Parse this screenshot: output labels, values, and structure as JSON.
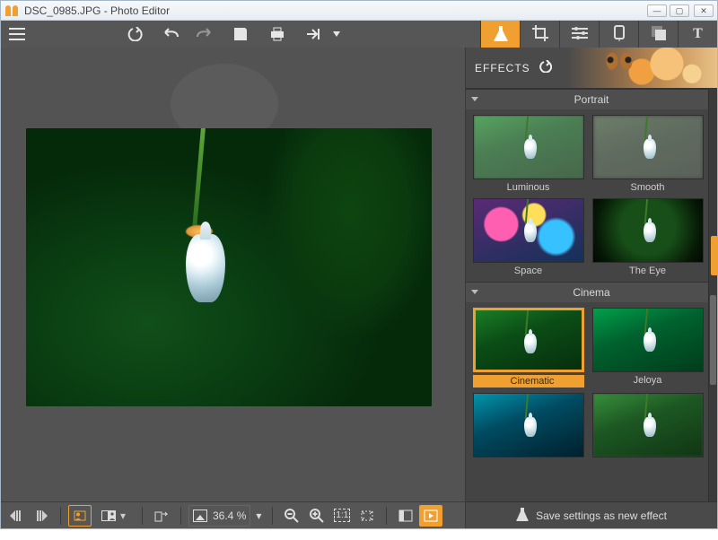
{
  "window": {
    "title": "DSC_0985.JPG - Photo Editor"
  },
  "toolbar": {
    "menu": "menu",
    "undo_big": "undo",
    "undo": "undo-step",
    "redo": "redo-step",
    "save": "save",
    "print": "print",
    "export": "export"
  },
  "mode_tabs": [
    {
      "id": "effects",
      "icon": "flask-icon",
      "active": true
    },
    {
      "id": "crop",
      "icon": "crop-icon",
      "active": false
    },
    {
      "id": "adjust",
      "icon": "sliders-icon",
      "active": false
    },
    {
      "id": "retouch",
      "icon": "retouch-icon",
      "active": false
    },
    {
      "id": "overlay",
      "icon": "overlay-icon",
      "active": false
    },
    {
      "id": "text",
      "icon": "text-icon",
      "active": false
    }
  ],
  "effects": {
    "header_label": "EFFECTS",
    "categories": [
      {
        "name": "Portrait",
        "items": [
          {
            "label": "Luminous",
            "fx": "fx-luminous",
            "selected": false
          },
          {
            "label": "Smooth",
            "fx": "fx-smooth",
            "selected": false
          },
          {
            "label": "Space",
            "fx": "fx-space",
            "selected": false
          },
          {
            "label": "The Eye",
            "fx": "fx-theeye",
            "selected": false
          }
        ]
      },
      {
        "name": "Cinema",
        "items": [
          {
            "label": "Cinematic",
            "fx": "fx-cinematic",
            "selected": true
          },
          {
            "label": "Jeloya",
            "fx": "fx-jeloya",
            "selected": false
          },
          {
            "label": "",
            "fx": "fx-row3a",
            "selected": false
          },
          {
            "label": "",
            "fx": "fx-row3b",
            "selected": false
          }
        ]
      }
    ],
    "save_effect_label": "Save settings as new effect"
  },
  "bottom": {
    "zoom_label": "36.4 %"
  }
}
